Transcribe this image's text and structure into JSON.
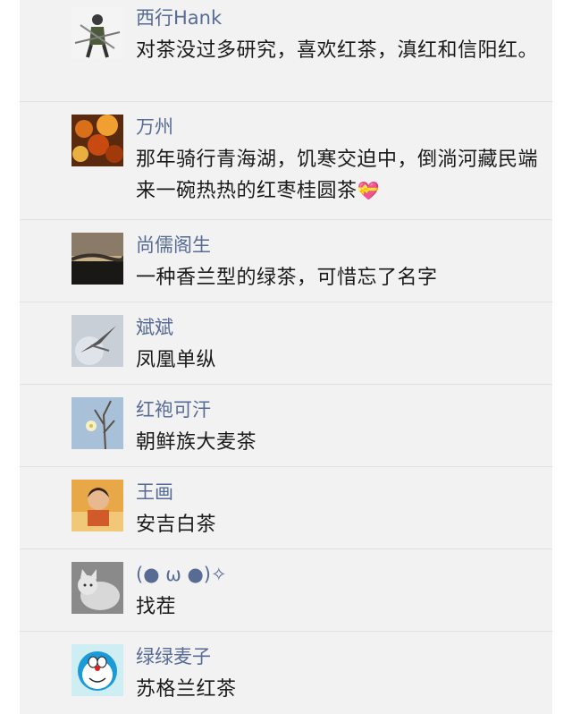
{
  "comments": [
    {
      "name": "西行Hank",
      "text": "对茶没过多研究，喜欢红茶，滇红和信阳红。",
      "avatar": "swordsman-avatar"
    },
    {
      "name": "万州",
      "text": "那年骑行青海湖，饥寒交迫中，倒淌河藏民端来一碗热热的红枣桂圆茶",
      "emoji": "💝",
      "avatar": "autumn-leaves-avatar"
    },
    {
      "name": "尚儒阁生",
      "text": "一种香兰型的绿茶，可惜忘了名字",
      "avatar": "sunset-lake-avatar"
    },
    {
      "name": "斌斌",
      "text": "凤凰单纵",
      "avatar": "flying-bird-avatar"
    },
    {
      "name": "红袍可汗",
      "text": "朝鲜族大麦茶",
      "avatar": "flower-branch-avatar"
    },
    {
      "name": "王画",
      "text": "安吉白茶",
      "avatar": "child-photo-avatar"
    },
    {
      "name": "(● ω ●)✧",
      "text": "找茬",
      "avatar": "cat-avatar"
    },
    {
      "name": "绿绿麦子",
      "text": "苏格兰红茶",
      "avatar": "doraemon-avatar"
    }
  ]
}
